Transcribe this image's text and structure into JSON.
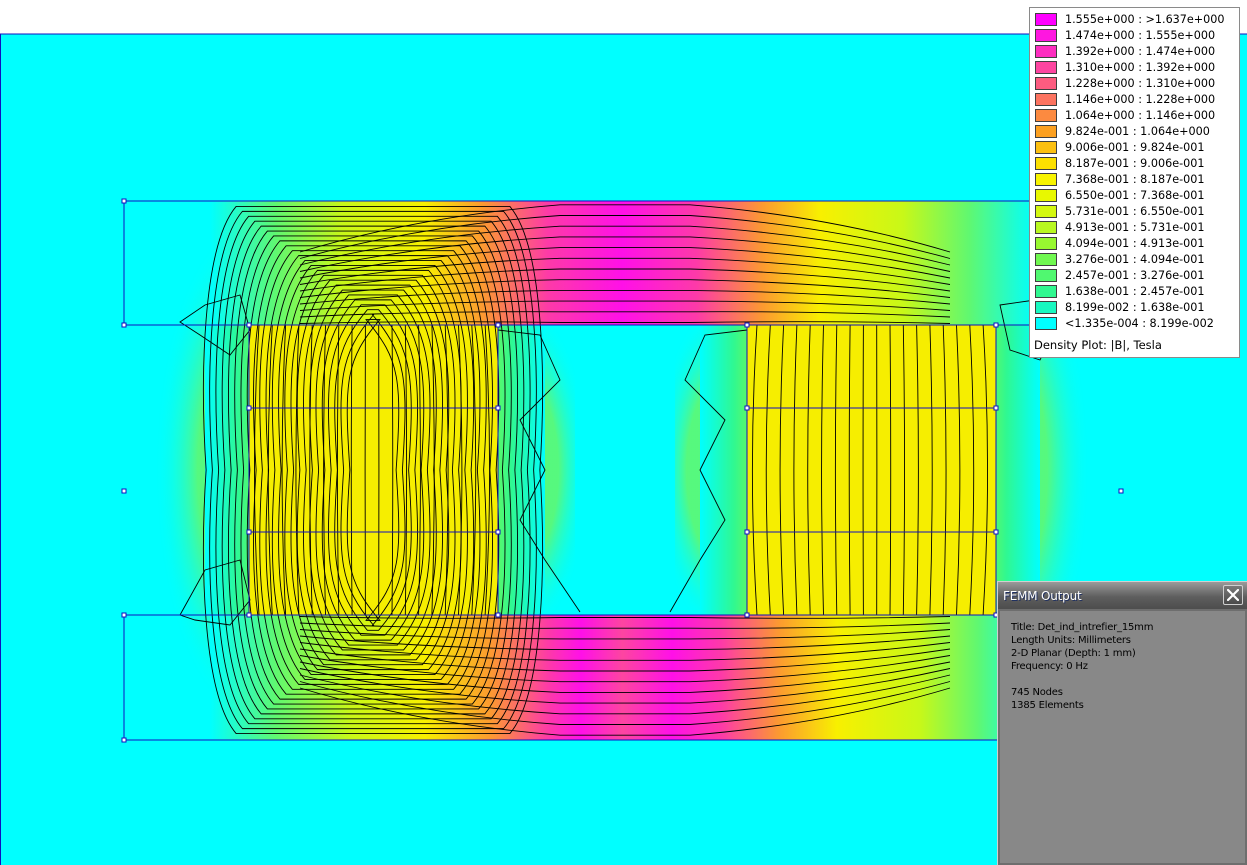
{
  "plot": {
    "background_color": "#00ffff",
    "outline_color": "#1010c0",
    "contour_color": "#000000"
  },
  "legend": {
    "entries": [
      {
        "range": "1.555e+000 : >1.637e+000",
        "color": "#ff00ff"
      },
      {
        "range": "1.474e+000 : 1.555e+000",
        "color": "#fe17e0"
      },
      {
        "range": "1.392e+000 : 1.474e+000",
        "color": "#fd2ec0"
      },
      {
        "range": "1.310e+000 : 1.392e+000",
        "color": "#fd45a0"
      },
      {
        "range": "1.228e+000 : 1.310e+000",
        "color": "#fc5c80"
      },
      {
        "range": "1.146e+000 : 1.228e+000",
        "color": "#fc7360"
      },
      {
        "range": "1.064e+000 : 1.146e+000",
        "color": "#fc8a40"
      },
      {
        "range": "9.824e-001 : 1.064e+000",
        "color": "#fca020"
      },
      {
        "range": "9.006e-001 : 9.824e-001",
        "color": "#fcc010"
      },
      {
        "range": "8.187e-001 : 9.006e-001",
        "color": "#fce000"
      },
      {
        "range": "7.368e-001 : 8.187e-001",
        "color": "#f8f400"
      },
      {
        "range": "6.550e-001 : 7.368e-001",
        "color": "#e8f800"
      },
      {
        "range": "5.731e-001 : 6.550e-001",
        "color": "#d4f810"
      },
      {
        "range": "4.913e-001 : 5.731e-001",
        "color": "#b8f820"
      },
      {
        "range": "4.094e-001 : 4.913e-001",
        "color": "#98f830"
      },
      {
        "range": "3.276e-001 : 4.094e-001",
        "color": "#70f850"
      },
      {
        "range": "2.457e-001 : 3.276e-001",
        "color": "#50f870"
      },
      {
        "range": "1.638e-001 : 2.457e-001",
        "color": "#30f890"
      },
      {
        "range": "8.199e-002 : 1.638e-001",
        "color": "#18f8c0"
      },
      {
        "range": "<1.335e-004 : 8.199e-002",
        "color": "#00ffff"
      }
    ],
    "caption": "Density Plot: |B|, Tesla"
  },
  "output": {
    "title": "FEMM Output",
    "lines": [
      "Title: Det_ind_intrefier_15mm",
      "Length Units: Millimeters",
      "2-D Planar (Depth: 1 mm)",
      "Frequency: 0 Hz",
      "",
      "745 Nodes",
      "1385 Elements"
    ],
    "close_icon": "close-icon"
  }
}
